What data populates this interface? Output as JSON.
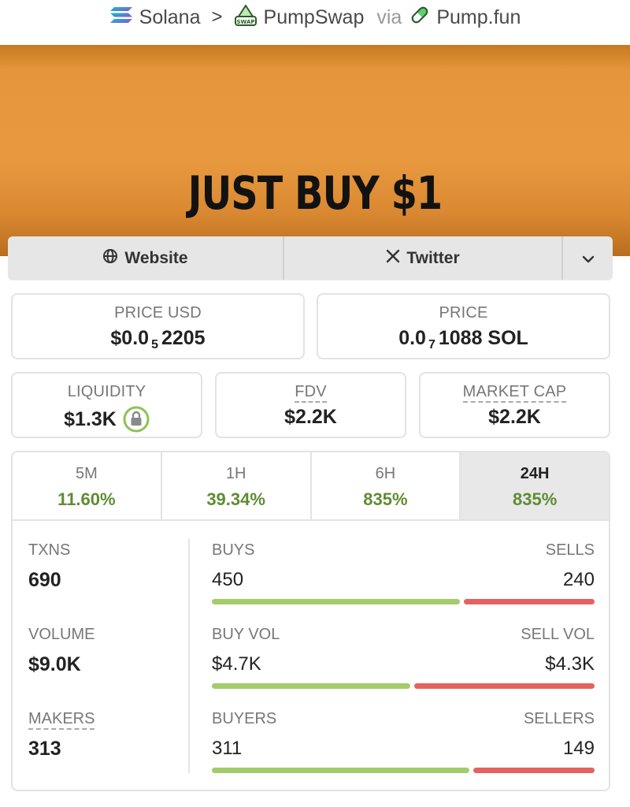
{
  "breadcrumb": {
    "chain": "Solana",
    "separator": ">",
    "dex": "PumpSwap",
    "via": "via",
    "launchpad": "Pump.fun",
    "dex_icon_text": "SWAP"
  },
  "banner": {
    "text": "JUST BUY $1"
  },
  "links": {
    "website": "Website",
    "twitter": "Twitter"
  },
  "price_usd": {
    "label": "PRICE USD",
    "prefix": "$0.0",
    "zeros": "5",
    "digits": "2205"
  },
  "price_native": {
    "label": "PRICE",
    "prefix": "0.0",
    "zeros": "7",
    "digits": "1088 SOL"
  },
  "liquidity": {
    "label": "LIQUIDITY",
    "value": "$1.3K"
  },
  "fdv": {
    "label": "FDV",
    "value": "$2.2K"
  },
  "market_cap": {
    "label": "MARKET CAP",
    "value": "$2.2K"
  },
  "timeframes": [
    {
      "label": "5M",
      "change": "11.60%"
    },
    {
      "label": "1H",
      "change": "39.34%"
    },
    {
      "label": "6H",
      "change": "835%"
    },
    {
      "label": "24H",
      "change": "835%"
    }
  ],
  "selected_timeframe": "24H",
  "txns": {
    "label": "TXNS",
    "value": "690",
    "buys_label": "BUYS",
    "buys": "450",
    "sells_label": "SELLS",
    "sells": "240",
    "buy_fraction": 0.652
  },
  "volume": {
    "label": "VOLUME",
    "value": "$9.0K",
    "buys_label": "BUY VOL",
    "buys": "$4.7K",
    "sells_label": "SELL VOL",
    "sells": "$4.3K",
    "buy_fraction": 0.522
  },
  "makers": {
    "label": "MAKERS",
    "value": "313",
    "buys_label": "BUYERS",
    "buys": "311",
    "sells_label": "SELLERS",
    "sells": "149",
    "buy_fraction": 0.676
  },
  "colors": {
    "accent_orange": "#e8993f",
    "positive_green": "#5e8c31",
    "buy_bar": "#a3cc6b",
    "sell_bar": "#e5625e"
  },
  "icons": [
    "solana-icon",
    "pumpswap-icon",
    "pumpfun-pill-icon",
    "globe-icon",
    "x-icon",
    "chevron-down-icon",
    "lock-icon"
  ]
}
